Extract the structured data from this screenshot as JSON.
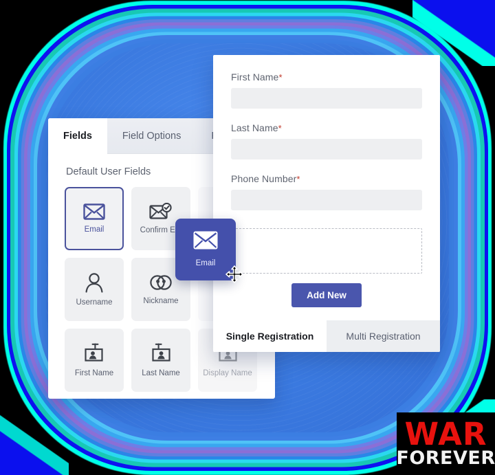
{
  "background": {
    "ring_colors": [
      "#00ffe8",
      "#0e12f0",
      "#18c8b4",
      "#2bd8ef",
      "#2a86e8",
      "#5f7fe0",
      "#8b6fd6",
      "#6e7ee6",
      "#39a7f0",
      "#4fc3f7",
      "#3e7fe4"
    ],
    "core_color": "#3b7ae0"
  },
  "left_panel": {
    "tabs": [
      {
        "label": "Fields",
        "active": true
      },
      {
        "label": "Field Options",
        "active": false
      },
      {
        "label": "For",
        "active": false
      }
    ],
    "section_title": "Default User Fields",
    "tiles": [
      {
        "label": "Email",
        "icon": "envelope-icon",
        "selected": true
      },
      {
        "label": "Confirm Em",
        "icon": "envelope-check-icon",
        "selected": false
      },
      {
        "label": "",
        "icon": "blank-icon",
        "selected": false
      },
      {
        "label": "Username",
        "icon": "user-icon",
        "selected": false
      },
      {
        "label": "Nickname",
        "icon": "goggles-icon",
        "selected": false
      },
      {
        "label": "",
        "icon": "blank-icon",
        "selected": false
      },
      {
        "label": "First Name",
        "icon": "id-card-icon",
        "selected": false
      },
      {
        "label": "Last Name",
        "icon": "id-card-icon",
        "selected": false
      },
      {
        "label": "Display Name",
        "icon": "id-card-icon",
        "selected": false
      }
    ]
  },
  "right_panel": {
    "fields": [
      {
        "label": "First Name",
        "required": "*",
        "value": "",
        "placeholder": ""
      },
      {
        "label": "Last Name",
        "required": "*",
        "value": "",
        "placeholder": ""
      },
      {
        "label": "Phone Number",
        "required": "*",
        "value": "",
        "placeholder": ""
      }
    ],
    "dropzone_label": "",
    "add_button": "Add New",
    "bottom_tabs": [
      {
        "label": "Single Registration",
        "active": true
      },
      {
        "label": "Multi Registration",
        "active": false
      }
    ]
  },
  "drag_ghost": {
    "label": "Email",
    "icon": "envelope-icon",
    "color": "#4450ab",
    "cursor": "move-cursor"
  },
  "watermark": {
    "line1": "WAR",
    "line2": "FOREVER",
    "line1_color": "#e8120e",
    "line2_color": "#f2f2f2",
    "background": "#000000"
  }
}
